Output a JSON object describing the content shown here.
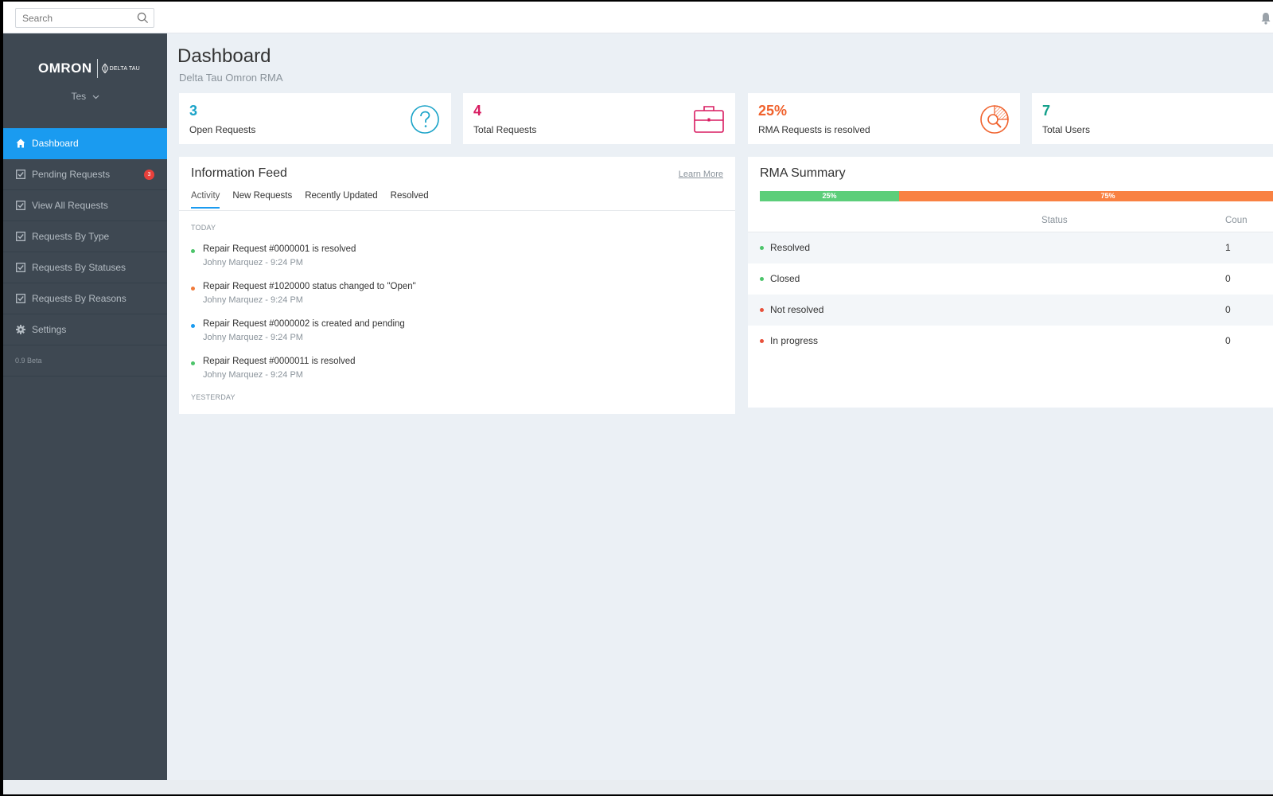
{
  "search": {
    "placeholder": "Search"
  },
  "sidebar": {
    "logo_primary": "OMRON",
    "logo_secondary": "DELTA TAU",
    "user": "Tes",
    "items": [
      {
        "label": "Dashboard",
        "icon": "home-icon",
        "active": true
      },
      {
        "label": "Pending Requests",
        "icon": "checkbox-icon",
        "badge": "3"
      },
      {
        "label": "View All Requests",
        "icon": "checkbox-icon"
      },
      {
        "label": "Requests By Type",
        "icon": "checkbox-icon"
      },
      {
        "label": "Requests By Statuses",
        "icon": "checkbox-icon"
      },
      {
        "label": "Requests By Reasons",
        "icon": "checkbox-icon"
      },
      {
        "label": "Settings",
        "icon": "gear-icon"
      }
    ],
    "version": "0.9 Beta"
  },
  "header": {
    "title": "Dashboard",
    "subtitle": "Delta Tau Omron RMA"
  },
  "stats": [
    {
      "value": "3",
      "label": "Open Requests",
      "color": "#1aa3c8",
      "icon": "question-circle-icon"
    },
    {
      "value": "4",
      "label": "Total Requests",
      "color": "#d81b60",
      "icon": "briefcase-icon"
    },
    {
      "value": "25%",
      "label": "RMA Requests is resolved",
      "color": "#f0622d",
      "icon": "pie-magnifier-icon"
    },
    {
      "value": "7",
      "label": "Total Users",
      "color": "#12a08a"
    }
  ],
  "feed": {
    "title": "Information Feed",
    "learn_more": "Learn More",
    "tabs": [
      "Activity",
      "New Requests",
      "Recently Updated",
      "Resolved"
    ],
    "today_label": "TODAY",
    "yesterday_label": "YESTERDAY",
    "items": [
      {
        "text": "Repair Request #0000001 is resolved",
        "meta": "Johny Marquez - 9:24 PM",
        "color": "#4cc46a"
      },
      {
        "text": "Repair Request #1020000 status changed to \"Open\"",
        "meta": "Johny Marquez - 9:24 PM",
        "color": "#f07a3a"
      },
      {
        "text": "Repair Request #0000002 is created and pending",
        "meta": "Johny Marquez - 9:24 PM",
        "color": "#1a9bf0"
      },
      {
        "text": "Repair Request #0000011 is resolved",
        "meta": "Johny Marquez - 9:24 PM",
        "color": "#4cc46a"
      }
    ]
  },
  "summary": {
    "title": "RMA Summary",
    "progress": [
      {
        "label": "25%",
        "fraction": 0.25,
        "color": "#5cce7a"
      },
      {
        "label": "75%",
        "fraction": 0.75,
        "color": "#f98142"
      }
    ],
    "col_status": "Status",
    "col_count": "Coun",
    "rows": [
      {
        "name": "Resolved",
        "count": "1",
        "color": "#4cc46a"
      },
      {
        "name": "Closed",
        "count": "0",
        "color": "#4cc46a"
      },
      {
        "name": "Not resolved",
        "count": "0",
        "color": "#e8513b"
      },
      {
        "name": "In progress",
        "count": "0",
        "color": "#e8513b"
      }
    ]
  }
}
